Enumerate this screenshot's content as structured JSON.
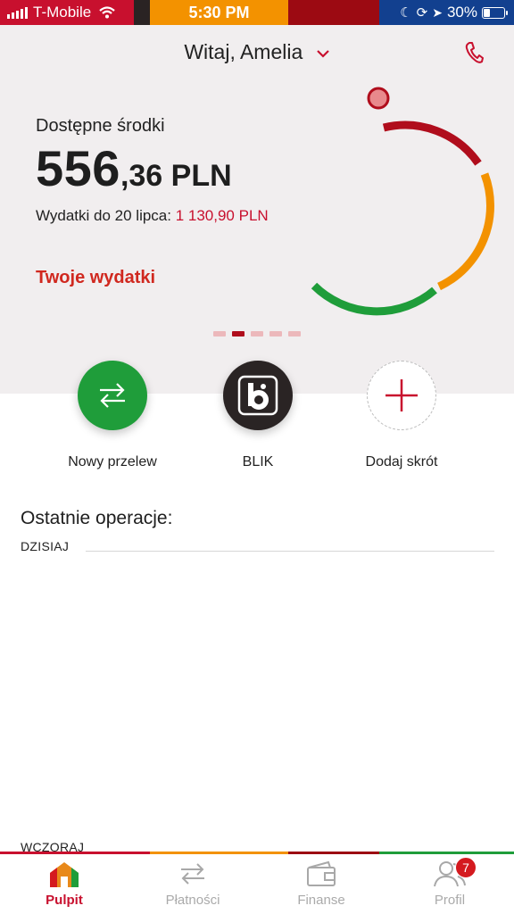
{
  "status_bar": {
    "carrier": "T-Mobile",
    "time": "5:30 PM",
    "battery": "30%",
    "battery_level": 0.3
  },
  "header": {
    "greeting": "Witaj, Amelia"
  },
  "balance": {
    "label": "Dostępne środki",
    "integer": "556",
    "decimal": ",36 PLN"
  },
  "spending": {
    "prefix": "Wydatki do 20 lipca: ",
    "amount": "1 130,90 PLN",
    "link": "Twoje wydatki"
  },
  "carousel": {
    "pages": 5,
    "active_index": 1
  },
  "colors": {
    "brand_red": "#c8102e",
    "dark_red": "#b00d1c",
    "orange": "#f39200",
    "green": "#1f9d3a",
    "blue": "#12408f"
  },
  "quick_actions": [
    {
      "label": "Nowy przelew",
      "icon": "transfer-arrows-icon"
    },
    {
      "label": "BLIK",
      "icon": "blik-logo-icon"
    },
    {
      "label": "Dodaj skrót",
      "icon": "plus-icon"
    }
  ],
  "operations": {
    "title": "Ostatnie operacje:",
    "today": "DZISIAJ",
    "yesterday": "WCZORAJ"
  },
  "tabs": [
    {
      "label": "Pulpit",
      "icon": "home-icon",
      "active": true
    },
    {
      "label": "Płatności",
      "icon": "transfer-arrows-icon",
      "active": false
    },
    {
      "label": "Finanse",
      "icon": "wallet-icon",
      "active": false
    },
    {
      "label": "Profil",
      "icon": "users-icon",
      "active": false,
      "badge": "7"
    }
  ]
}
